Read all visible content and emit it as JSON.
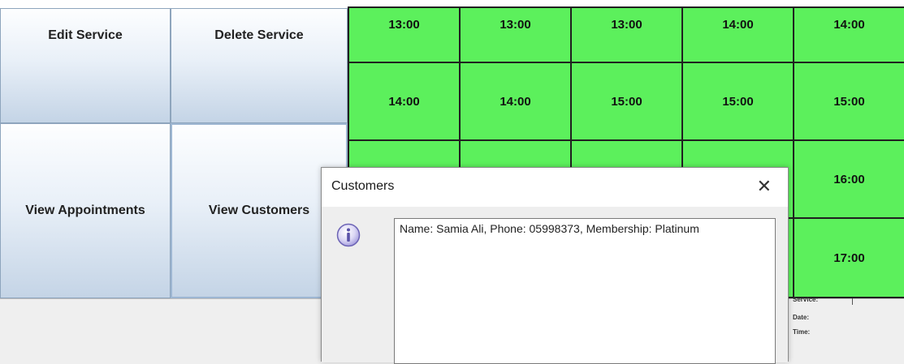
{
  "buttons": {
    "edit_service": "Edit Service",
    "delete_service": "Delete Service",
    "view_appointments": "View Appointments",
    "view_customers": "View Customers"
  },
  "time_grid": {
    "row1": [
      "13:00",
      "13:00",
      "13:00",
      "14:00",
      "14:00"
    ],
    "row2": [
      "14:00",
      "14:00",
      "15:00",
      "15:00",
      "15:00"
    ],
    "row3_last": "16:00",
    "row4_last": "17:00"
  },
  "details_panel": {
    "service_label": "Service:",
    "date_label": "Date:",
    "time_label": "Time:"
  },
  "dialog": {
    "title": "Customers",
    "close_glyph": "✕",
    "message": "Name: Samia Ali, Phone: 05998373, Membership: Platinum"
  },
  "colors": {
    "slot_green": "#5cf05c",
    "button_gradient_bottom": "#c4d4e6"
  },
  "icons": {
    "dialog": "info-icon"
  }
}
